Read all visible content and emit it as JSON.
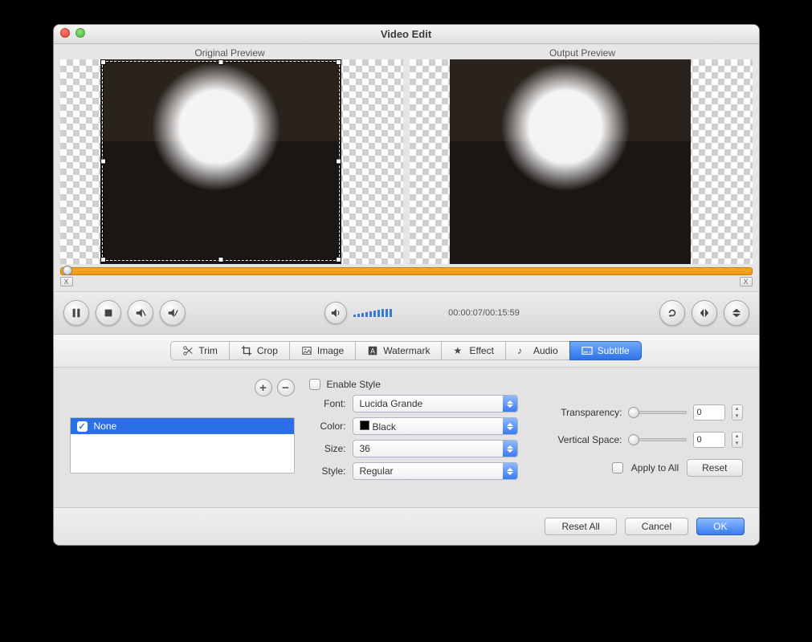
{
  "window": {
    "title": "Video Edit"
  },
  "previews": {
    "original_label": "Original Preview",
    "output_label": "Output Preview"
  },
  "timeline": {
    "trim_left_label": "X",
    "trim_right_label": "X"
  },
  "transport": {
    "time_readout": "00:00:07/00:15:59"
  },
  "tabs": {
    "trim": "Trim",
    "crop": "Crop",
    "image": "Image",
    "watermark": "Watermark",
    "effect": "Effect",
    "audio": "Audio",
    "subtitle": "Subtitle",
    "active": "subtitle"
  },
  "subtitle_panel": {
    "list": [
      {
        "label": "None",
        "checked": true,
        "selected": true
      }
    ],
    "enable_style_label": "Enable Style",
    "enable_style_checked": false,
    "font_label": "Font:",
    "font_value": "Lucida Grande",
    "color_label": "Color:",
    "color_value": "Black",
    "color_swatch": "#000000",
    "size_label": "Size:",
    "size_value": "36",
    "style_label": "Style:",
    "style_value": "Regular",
    "transparency_label": "Transparency:",
    "transparency_value": "0",
    "vertical_space_label": "Vertical Space:",
    "vertical_space_value": "0",
    "apply_to_all_label": "Apply to All",
    "apply_to_all_checked": false,
    "reset_label": "Reset"
  },
  "footer": {
    "reset_all": "Reset All",
    "cancel": "Cancel",
    "ok": "OK"
  }
}
